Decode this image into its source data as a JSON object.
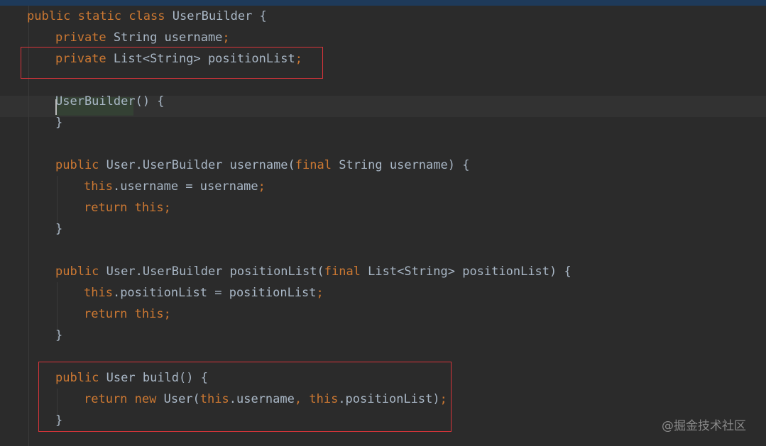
{
  "editor": {
    "lines": [
      {
        "indent": 0,
        "tokens": [
          {
            "t": "public ",
            "c": "keyword"
          },
          {
            "t": "static ",
            "c": "keyword"
          },
          {
            "t": "class ",
            "c": "keyword"
          },
          {
            "t": "UserBuilder {",
            "c": "plain"
          }
        ]
      },
      {
        "indent": 1,
        "tokens": [
          {
            "t": "private ",
            "c": "keyword"
          },
          {
            "t": "String username",
            "c": "plain"
          },
          {
            "t": ";",
            "c": "punct"
          }
        ]
      },
      {
        "indent": 1,
        "tokens": [
          {
            "t": "private ",
            "c": "keyword"
          },
          {
            "t": "List<String> positionList",
            "c": "plain"
          },
          {
            "t": ";",
            "c": "punct"
          }
        ]
      },
      {
        "indent": 0,
        "tokens": []
      },
      {
        "indent": 1,
        "tokens": [
          {
            "t": "UserBuilder",
            "c": "constructor"
          },
          {
            "t": "() {",
            "c": "plain"
          }
        ]
      },
      {
        "indent": 1,
        "tokens": [
          {
            "t": "}",
            "c": "plain"
          }
        ]
      },
      {
        "indent": 0,
        "tokens": []
      },
      {
        "indent": 1,
        "tokens": [
          {
            "t": "public ",
            "c": "keyword"
          },
          {
            "t": "User.UserBuilder ",
            "c": "plain"
          },
          {
            "t": "username",
            "c": "method"
          },
          {
            "t": "(",
            "c": "plain"
          },
          {
            "t": "final ",
            "c": "keyword"
          },
          {
            "t": "String username) {",
            "c": "plain"
          }
        ]
      },
      {
        "indent": 2,
        "tokens": [
          {
            "t": "this",
            "c": "keyword"
          },
          {
            "t": ".username = username",
            "c": "plain"
          },
          {
            "t": ";",
            "c": "punct"
          }
        ]
      },
      {
        "indent": 2,
        "tokens": [
          {
            "t": "return ",
            "c": "keyword"
          },
          {
            "t": "this",
            "c": "keyword"
          },
          {
            "t": ";",
            "c": "punct"
          }
        ]
      },
      {
        "indent": 1,
        "tokens": [
          {
            "t": "}",
            "c": "plain"
          }
        ]
      },
      {
        "indent": 0,
        "tokens": []
      },
      {
        "indent": 1,
        "tokens": [
          {
            "t": "public ",
            "c": "keyword"
          },
          {
            "t": "User.UserBuilder ",
            "c": "plain"
          },
          {
            "t": "positionList",
            "c": "method"
          },
          {
            "t": "(",
            "c": "plain"
          },
          {
            "t": "final ",
            "c": "keyword"
          },
          {
            "t": "List<String> positionList) {",
            "c": "plain"
          }
        ]
      },
      {
        "indent": 2,
        "tokens": [
          {
            "t": "this",
            "c": "keyword"
          },
          {
            "t": ".positionList = positionList",
            "c": "plain"
          },
          {
            "t": ";",
            "c": "punct"
          }
        ]
      },
      {
        "indent": 2,
        "tokens": [
          {
            "t": "return ",
            "c": "keyword"
          },
          {
            "t": "this",
            "c": "keyword"
          },
          {
            "t": ";",
            "c": "punct"
          }
        ]
      },
      {
        "indent": 1,
        "tokens": [
          {
            "t": "}",
            "c": "plain"
          }
        ]
      },
      {
        "indent": 0,
        "tokens": []
      },
      {
        "indent": 1,
        "tokens": [
          {
            "t": "public ",
            "c": "keyword"
          },
          {
            "t": "User ",
            "c": "plain"
          },
          {
            "t": "build",
            "c": "method"
          },
          {
            "t": "() {",
            "c": "plain"
          }
        ]
      },
      {
        "indent": 2,
        "tokens": [
          {
            "t": "return ",
            "c": "keyword"
          },
          {
            "t": "new ",
            "c": "keyword"
          },
          {
            "t": "User(",
            "c": "plain"
          },
          {
            "t": "this",
            "c": "keyword"
          },
          {
            "t": ".username",
            "c": "plain"
          },
          {
            "t": ", ",
            "c": "punct"
          },
          {
            "t": "this",
            "c": "keyword"
          },
          {
            "t": ".positionList)",
            "c": "plain"
          },
          {
            "t": ";",
            "c": "punct"
          }
        ]
      },
      {
        "indent": 1,
        "tokens": [
          {
            "t": "}",
            "c": "plain"
          }
        ]
      }
    ]
  },
  "colors": {
    "background": "#2b2b2b",
    "keyword": "#cc7832",
    "plain": "#a9b7c6",
    "highlight_box": "#d8343a"
  },
  "watermark": "@掘金技术社区"
}
